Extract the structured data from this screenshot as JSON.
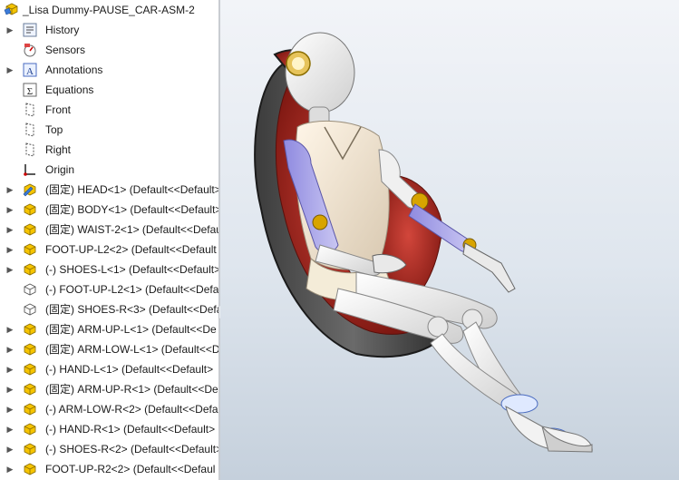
{
  "assembly": {
    "name": "_Lisa Dummy-PAUSE_CAR-ASM-2",
    "icon": "assembly-icon"
  },
  "tree": {
    "items": [
      {
        "label": "History",
        "icon": "history-icon",
        "expandable": true
      },
      {
        "label": "Sensors",
        "icon": "sensors-icon",
        "expandable": false
      },
      {
        "label": "Annotations",
        "icon": "annotations-icon",
        "expandable": true
      },
      {
        "label": "Equations",
        "icon": "equations-icon",
        "expandable": false
      },
      {
        "label": "Front",
        "icon": "plane-icon",
        "expandable": false
      },
      {
        "label": "Top",
        "icon": "plane-icon",
        "expandable": false
      },
      {
        "label": "Right",
        "icon": "plane-icon",
        "expandable": false
      },
      {
        "label": "Origin",
        "icon": "origin-icon",
        "expandable": false
      },
      {
        "label": "(固定) HEAD<1> (Default<<Default>",
        "icon": "part-edit-icon",
        "expandable": true
      },
      {
        "label": "(固定) BODY<1> (Default<<Default>",
        "icon": "part-icon",
        "expandable": true
      },
      {
        "label": "(固定) WAIST-2<1> (Default<<Defau",
        "icon": "part-icon",
        "expandable": true
      },
      {
        "label": "FOOT-UP-L2<2> (Default<<Default",
        "icon": "part-icon",
        "expandable": true
      },
      {
        "label": "(-) SHOES-L<1> (Default<<Default>",
        "icon": "part-icon",
        "expandable": true
      },
      {
        "label": "(-) FOOT-UP-L2<1> (Default<<Defa",
        "icon": "part-outline-icon",
        "expandable": false
      },
      {
        "label": "(固定) SHOES-R<3> (Default<<Defa",
        "icon": "part-outline-icon",
        "expandable": false
      },
      {
        "label": "(固定) ARM-UP-L<1> (Default<<De",
        "icon": "part-icon",
        "expandable": true
      },
      {
        "label": "(固定) ARM-LOW-L<1> (Default<<D",
        "icon": "part-icon",
        "expandable": true
      },
      {
        "label": "(-) HAND-L<1> (Default<<Default>",
        "icon": "part-icon",
        "expandable": true
      },
      {
        "label": "(固定) ARM-UP-R<1> (Default<<De",
        "icon": "part-icon",
        "expandable": true
      },
      {
        "label": "(-) ARM-LOW-R<2> (Default<<Defa",
        "icon": "part-icon",
        "expandable": true
      },
      {
        "label": "(-) HAND-R<1> (Default<<Default>",
        "icon": "part-icon",
        "expandable": true
      },
      {
        "label": "(-) SHOES-R<2> (Default<<Default>",
        "icon": "part-icon",
        "expandable": true
      },
      {
        "label": "FOOT-UP-R2<2> (Default<<Defaul",
        "icon": "part-icon",
        "expandable": true
      }
    ]
  },
  "splitter": {
    "grip_glyph": "◦"
  },
  "colors": {
    "part_yellow": "#f5c400",
    "seat_red": "#b82a22",
    "limb_blue": "#a8a4e8",
    "body_white": "#f2f2f2"
  }
}
